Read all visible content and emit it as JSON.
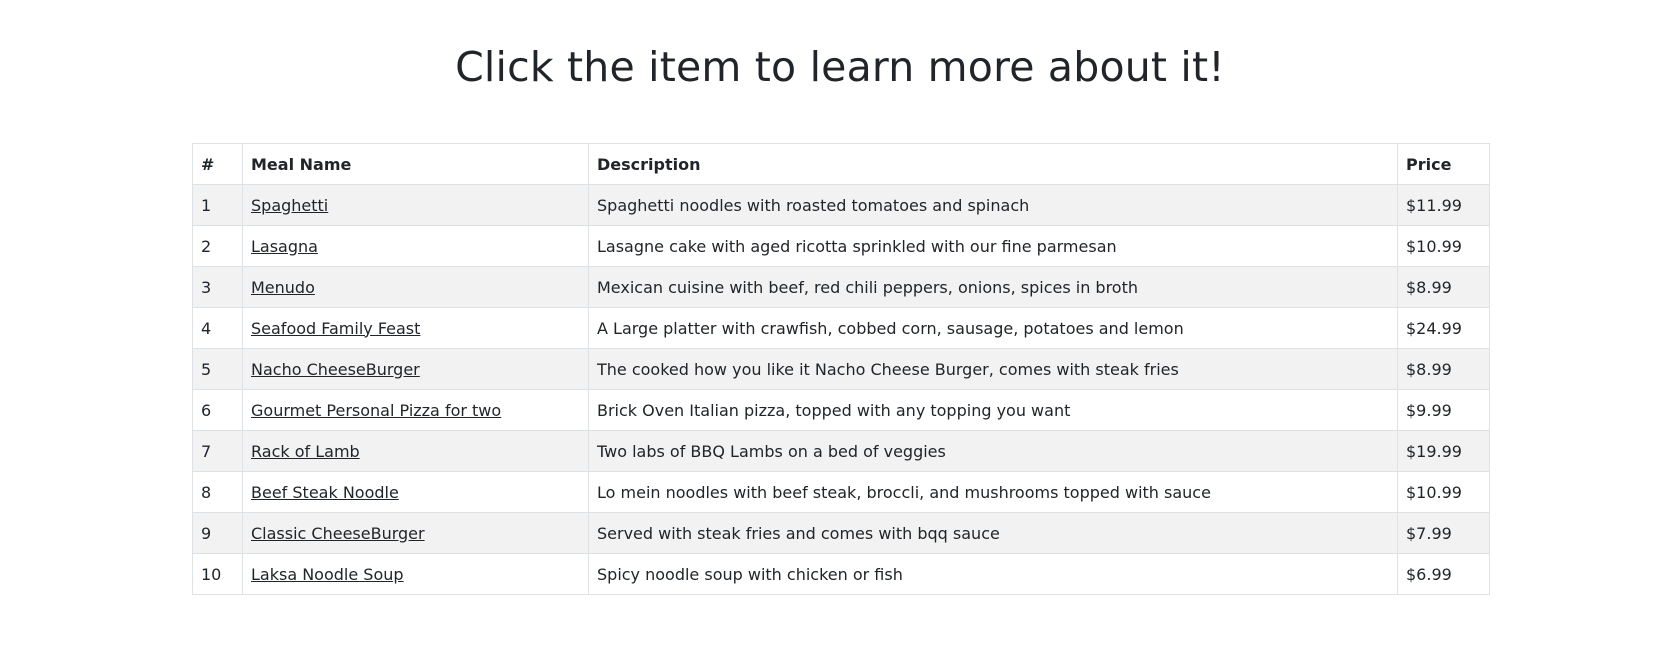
{
  "page": {
    "title": "Click the item to learn more about it!"
  },
  "table": {
    "headers": {
      "number": "#",
      "meal_name": "Meal Name",
      "description": "Description",
      "price": "Price"
    },
    "rows": [
      {
        "number": "1",
        "name": "Spaghetti",
        "description": "Spaghetti noodles with roasted tomatoes and spinach",
        "price": "$11.99"
      },
      {
        "number": "2",
        "name": "Lasagna",
        "description": "Lasagne cake with aged ricotta sprinkled with our fine parmesan",
        "price": "$10.99"
      },
      {
        "number": "3",
        "name": "Menudo",
        "description": "Mexican cuisine with beef, red chili peppers, onions, spices in broth",
        "price": "$8.99"
      },
      {
        "number": "4",
        "name": "Seafood Family Feast",
        "description": "A Large platter with crawfish, cobbed corn, sausage, potatoes and lemon",
        "price": "$24.99"
      },
      {
        "number": "5",
        "name": "Nacho CheeseBurger",
        "description": "The cooked how you like it Nacho Cheese Burger, comes with steak fries",
        "price": "$8.99"
      },
      {
        "number": "6",
        "name": "Gourmet Personal Pizza for two",
        "description": "Brick Oven Italian pizza, topped with any topping you want",
        "price": "$9.99"
      },
      {
        "number": "7",
        "name": "Rack of Lamb",
        "description": "Two labs of BBQ Lambs on a bed of veggies",
        "price": "$19.99"
      },
      {
        "number": "8",
        "name": "Beef Steak Noodle",
        "description": "Lo mein noodles with beef steak, broccli, and mushrooms topped with sauce",
        "price": "$10.99"
      },
      {
        "number": "9",
        "name": "Classic CheeseBurger",
        "description": "Served with steak fries and comes with bqq sauce",
        "price": "$7.99"
      },
      {
        "number": "10",
        "name": "Laksa Noodle Soup",
        "description": "Spicy noodle soup with chicken or fish",
        "price": "$6.99"
      }
    ]
  }
}
